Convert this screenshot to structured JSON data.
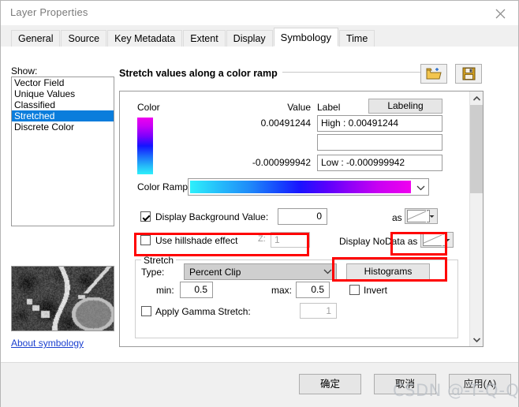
{
  "window": {
    "title": "Layer Properties",
    "close_icon": "close-icon"
  },
  "tabs": [
    {
      "label": "General",
      "active": false
    },
    {
      "label": "Source",
      "active": false
    },
    {
      "label": "Key Metadata",
      "active": false
    },
    {
      "label": "Extent",
      "active": false
    },
    {
      "label": "Display",
      "active": false
    },
    {
      "label": "Symbology",
      "active": true
    },
    {
      "label": "Time",
      "active": false
    }
  ],
  "sidebar": {
    "show_label": "Show:",
    "items": [
      {
        "label": "Vector Field",
        "selected": false
      },
      {
        "label": "Unique Values",
        "selected": false
      },
      {
        "label": "Classified",
        "selected": false
      },
      {
        "label": "Stretched",
        "selected": true
      },
      {
        "label": "Discrete Color",
        "selected": false
      }
    ],
    "preview_name": "layer-preview-thumbnail",
    "about_link": "About symbology"
  },
  "panel": {
    "header": "Stretch values along a color ramp",
    "open_icon": "folder-open-icon",
    "save_icon": "floppy-save-icon",
    "columns": {
      "color": "Color",
      "value": "Value",
      "label": "Label"
    },
    "labeling_button": "Labeling",
    "high": {
      "value": "0.00491244",
      "label": "High : 0.00491244"
    },
    "middle": {
      "value": "",
      "label": ""
    },
    "low": {
      "value": "-0.000999942",
      "label": "Low : -0.000999942"
    },
    "color_ramp_label": "Color Ramp:",
    "color_ramp_colors": [
      "#2ef0fb",
      "#1b12ff",
      "#9200f7",
      "#f000ef"
    ],
    "swatch_colors": [
      "#ee00ee",
      "#1414ff",
      "#2ef0fb"
    ],
    "background": {
      "checkbox_label": "Display Background Value:",
      "checked": true,
      "value": "0",
      "as_label": "as",
      "swatch": "no-color-swatch"
    },
    "hillshade": {
      "checkbox_label": "Use hillshade effect",
      "checked": false,
      "z_label": "Z:",
      "z_value": "1"
    },
    "nodata": {
      "label": "Display NoData as",
      "swatch": "no-color-swatch"
    },
    "stretch": {
      "caption": "Stretch",
      "type_label": "Type:",
      "type_value": "Percent Clip",
      "histograms_button": "Histograms",
      "min_label": "min:",
      "min_value": "0.5",
      "max_label": "max:",
      "max_value": "0.5",
      "invert_label": "Invert",
      "invert_checked": false,
      "gamma_label": "Apply Gamma Stretch:",
      "gamma_checked": false,
      "gamma_value": "1"
    },
    "highlight_color": "#ff0000"
  },
  "footer": {
    "ok": "确定",
    "cancel": "取消",
    "apply": "应用(A)"
  },
  "watermark": "CSDN @-T-Q-Q-"
}
